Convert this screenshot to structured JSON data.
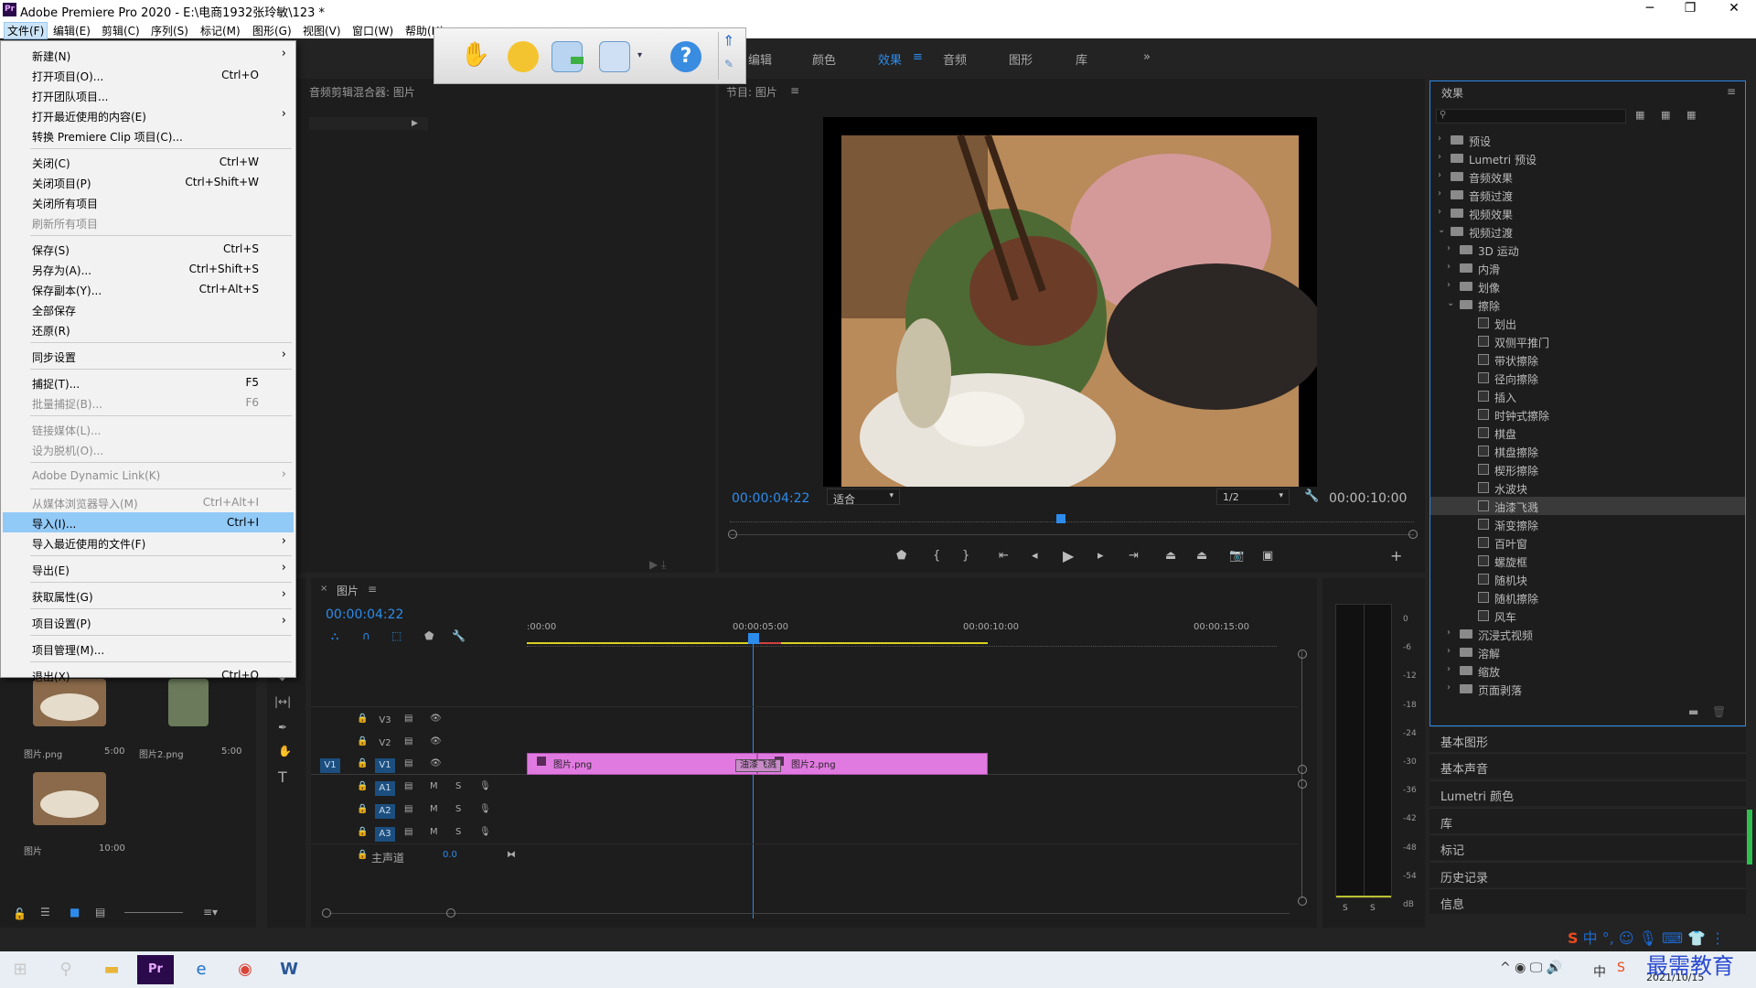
{
  "window": {
    "title": "Adobe Premiere Pro 2020 - E:\\电商1932张玲敏\\123 *",
    "app_icon": "Pr"
  },
  "menubar": [
    "文件(F)",
    "编辑(E)",
    "剪辑(C)",
    "序列(S)",
    "标记(M)",
    "图形(G)",
    "视图(V)",
    "窗口(W)",
    "帮助(H)"
  ],
  "workspace_tabs": [
    "编辑",
    "颜色",
    "效果",
    "音频",
    "图形",
    "库",
    "»"
  ],
  "file_menu": [
    {
      "label": "新建(N)",
      "shortcut": "",
      "arrow": true,
      "enabled": true
    },
    {
      "label": "打开项目(O)...",
      "shortcut": "Ctrl+O",
      "enabled": true
    },
    {
      "label": "打开团队项目...",
      "shortcut": "",
      "enabled": true
    },
    {
      "label": "打开最近使用的内容(E)",
      "shortcut": "",
      "arrow": true,
      "enabled": true
    },
    {
      "label": "转换 Premiere Clip 项目(C)...",
      "shortcut": "",
      "enabled": true
    },
    {
      "label": "关闭(C)",
      "shortcut": "Ctrl+W",
      "enabled": true
    },
    {
      "label": "关闭项目(P)",
      "shortcut": "Ctrl+Shift+W",
      "enabled": true
    },
    {
      "label": "关闭所有项目",
      "shortcut": "",
      "enabled": true
    },
    {
      "label": "刷新所有项目",
      "shortcut": "",
      "enabled": false
    },
    {
      "label": "保存(S)",
      "shortcut": "Ctrl+S",
      "enabled": true
    },
    {
      "label": "另存为(A)...",
      "shortcut": "Ctrl+Shift+S",
      "enabled": true
    },
    {
      "label": "保存副本(Y)...",
      "shortcut": "Ctrl+Alt+S",
      "enabled": true
    },
    {
      "label": "全部保存",
      "shortcut": "",
      "enabled": true
    },
    {
      "label": "还原(R)",
      "shortcut": "",
      "enabled": true
    },
    {
      "label": "同步设置",
      "shortcut": "",
      "arrow": true,
      "enabled": true
    },
    {
      "label": "捕捉(T)...",
      "shortcut": "F5",
      "enabled": true
    },
    {
      "label": "批量捕捉(B)...",
      "shortcut": "F6",
      "enabled": false
    },
    {
      "label": "链接媒体(L)...",
      "shortcut": "",
      "enabled": false
    },
    {
      "label": "设为脱机(O)...",
      "shortcut": "",
      "enabled": false
    },
    {
      "label": "Adobe Dynamic Link(K)",
      "shortcut": "",
      "arrow": true,
      "enabled": false
    },
    {
      "label": "从媒体浏览器导入(M)",
      "shortcut": "Ctrl+Alt+I",
      "enabled": false
    },
    {
      "label": "导入(I)...",
      "shortcut": "Ctrl+I",
      "enabled": true,
      "highlight": true
    },
    {
      "label": "导入最近使用的文件(F)",
      "shortcut": "",
      "arrow": true,
      "enabled": true
    },
    {
      "label": "导出(E)",
      "shortcut": "",
      "arrow": true,
      "enabled": true
    },
    {
      "label": "获取属性(G)",
      "shortcut": "",
      "arrow": true,
      "enabled": true
    },
    {
      "label": "项目设置(P)",
      "shortcut": "",
      "arrow": true,
      "enabled": true
    },
    {
      "label": "项目管理(M)...",
      "shortcut": "",
      "enabled": true
    },
    {
      "label": "退出(X)",
      "shortcut": "Ctrl+Q",
      "enabled": true
    }
  ],
  "audio_mixer": {
    "title": "音频剪辑混合器: 图片"
  },
  "program_monitor": {
    "title": "节目: 图片",
    "timecode_current": "00:00:04:22",
    "fit": "适合",
    "resolution": "1/2",
    "timecode_duration": "00:00:10:00"
  },
  "project_items": [
    {
      "name": "图片.png",
      "duration": "5:00"
    },
    {
      "name": "图片2.png",
      "duration": "5:00"
    },
    {
      "name": "图片",
      "duration": "10:00"
    }
  ],
  "timeline": {
    "tab": "图片",
    "timecode": "00:00:04:22",
    "ruler": [
      ":00:00",
      "00:00:05:00",
      "00:00:10:00",
      "00:00:15:00"
    ],
    "tracks": [
      "V3",
      "V2",
      "V1",
      "A1",
      "A2",
      "A3"
    ],
    "master": "主声道",
    "master_value": "0.0",
    "clips": [
      {
        "name": "图片.png"
      },
      {
        "name": "图片2.png"
      }
    ],
    "transition": "油漆飞溅"
  },
  "meter_scale": [
    "0",
    "-6",
    "-12",
    "-18",
    "-24",
    "-30",
    "-36",
    "-42",
    "-48",
    "-54",
    "dB"
  ],
  "effects": {
    "title": "效果",
    "tree": [
      {
        "label": "预设",
        "level": 0,
        "type": "bin",
        "open": false
      },
      {
        "label": "Lumetri 预设",
        "level": 0,
        "type": "bin",
        "open": false
      },
      {
        "label": "音频效果",
        "level": 0,
        "type": "folder",
        "open": false
      },
      {
        "label": "音频过渡",
        "level": 0,
        "type": "folder",
        "open": false
      },
      {
        "label": "视频效果",
        "level": 0,
        "type": "folder",
        "open": false
      },
      {
        "label": "视频过渡",
        "level": 0,
        "type": "folder",
        "open": true
      },
      {
        "label": "3D 运动",
        "level": 1,
        "type": "folder",
        "open": false
      },
      {
        "label": "内滑",
        "level": 1,
        "type": "folder",
        "open": false
      },
      {
        "label": "划像",
        "level": 1,
        "type": "folder",
        "open": false
      },
      {
        "label": "擦除",
        "level": 1,
        "type": "folder",
        "open": true
      },
      {
        "label": "划出",
        "level": 2,
        "type": "effect"
      },
      {
        "label": "双侧平推门",
        "level": 2,
        "type": "effect"
      },
      {
        "label": "带状擦除",
        "level": 2,
        "type": "effect"
      },
      {
        "label": "径向擦除",
        "level": 2,
        "type": "effect"
      },
      {
        "label": "插入",
        "level": 2,
        "type": "effect"
      },
      {
        "label": "时钟式擦除",
        "level": 2,
        "type": "effect"
      },
      {
        "label": "棋盘",
        "level": 2,
        "type": "effect"
      },
      {
        "label": "棋盘擦除",
        "level": 2,
        "type": "effect"
      },
      {
        "label": "楔形擦除",
        "level": 2,
        "type": "effect"
      },
      {
        "label": "水波块",
        "level": 2,
        "type": "effect"
      },
      {
        "label": "油漆飞溅",
        "level": 2,
        "type": "effect",
        "selected": true
      },
      {
        "label": "渐变擦除",
        "level": 2,
        "type": "effect"
      },
      {
        "label": "百叶窗",
        "level": 2,
        "type": "effect"
      },
      {
        "label": "螺旋框",
        "level": 2,
        "type": "effect"
      },
      {
        "label": "随机块",
        "level": 2,
        "type": "effect"
      },
      {
        "label": "随机擦除",
        "level": 2,
        "type": "effect"
      },
      {
        "label": "风车",
        "level": 2,
        "type": "effect"
      },
      {
        "label": "沉浸式视频",
        "level": 1,
        "type": "folder",
        "open": false
      },
      {
        "label": "溶解",
        "level": 1,
        "type": "folder",
        "open": false
      },
      {
        "label": "缩放",
        "level": 1,
        "type": "folder",
        "open": false
      },
      {
        "label": "页面剥落",
        "level": 1,
        "type": "folder",
        "open": false
      }
    ]
  },
  "side_panels": [
    "基本图形",
    "基本声音",
    "Lumetri 颜色",
    "库",
    "标记",
    "历史记录",
    "信息"
  ],
  "taskbar": {
    "date": "2021/10/15",
    "watermark": "最需教育",
    "ime": "中"
  }
}
